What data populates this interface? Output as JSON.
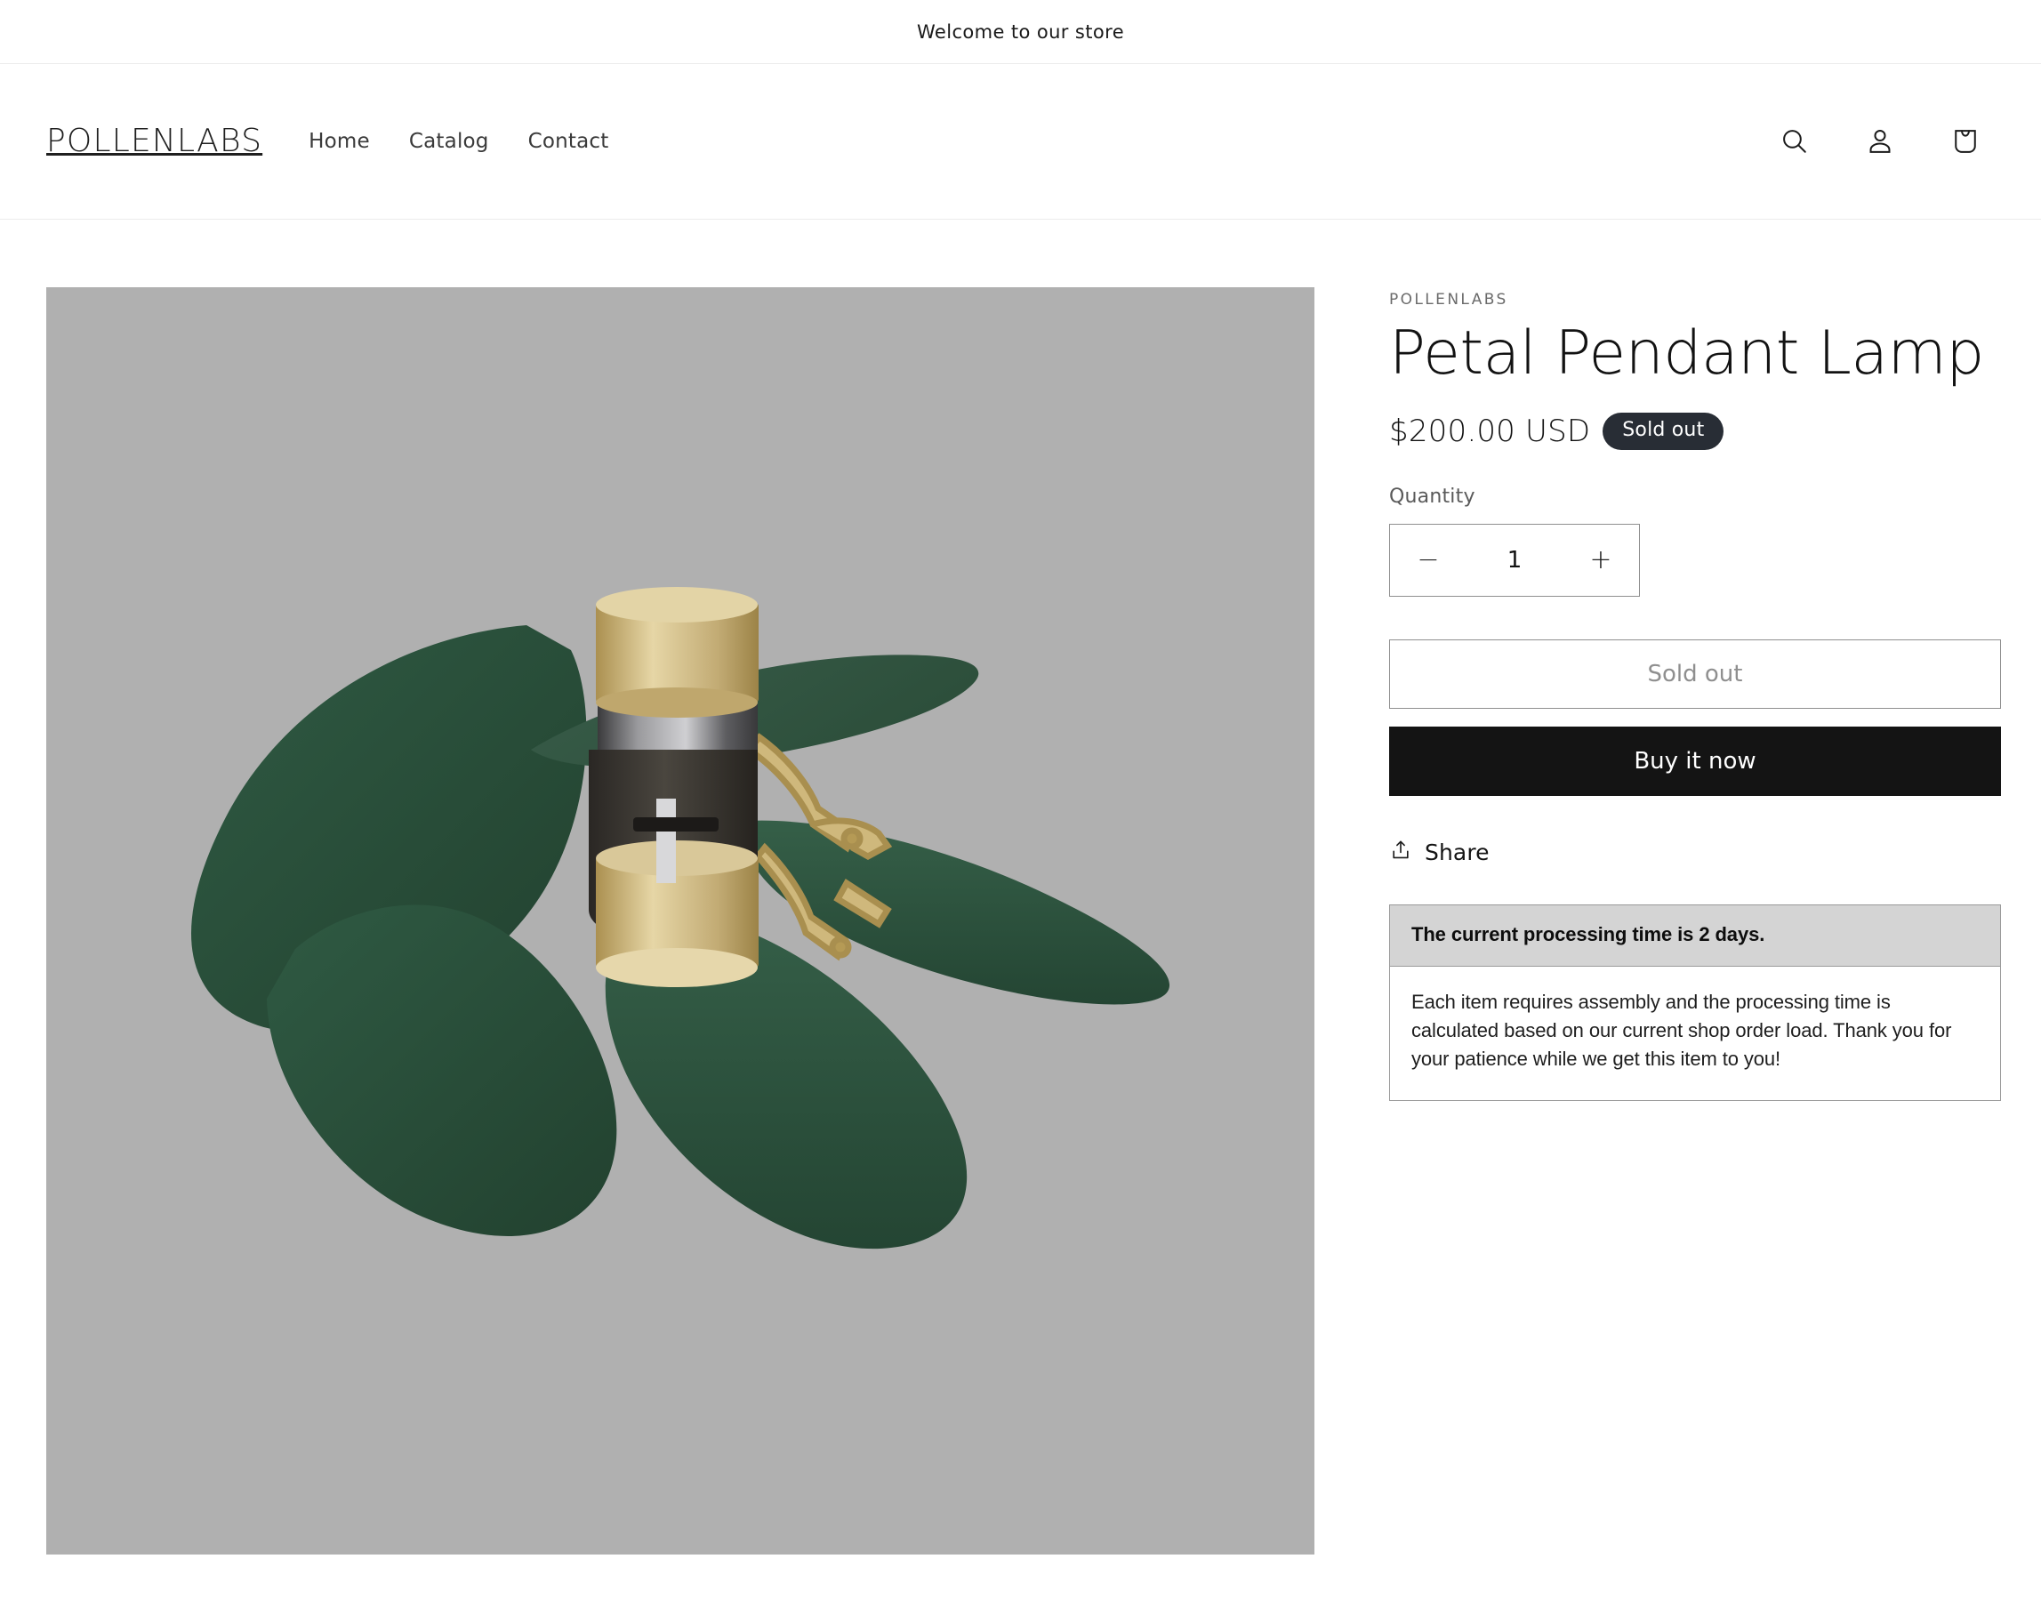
{
  "announcement": {
    "text": "Welcome to our store"
  },
  "header": {
    "logo": "POLLENLABS",
    "nav": [
      {
        "label": "Home"
      },
      {
        "label": "Catalog"
      },
      {
        "label": "Contact"
      }
    ],
    "icons": {
      "search": "search-icon",
      "account": "account-icon",
      "cart": "cart-icon"
    }
  },
  "product": {
    "vendor": "POLLENLABS",
    "title": "Petal Pendant Lamp",
    "price": "$200.00 USD",
    "availability_badge": "Sold out",
    "quantity": {
      "label": "Quantity",
      "value": "1",
      "decrease": "−",
      "increase": "+"
    },
    "actions": {
      "add_to_cart": "Sold out",
      "buy_now": "Buy it now"
    },
    "share": {
      "label": "Share",
      "icon": "share-icon"
    },
    "info_card": {
      "heading": "The current processing time is 2 days.",
      "body": "Each item requires assembly and the processing time is calculated based on our current shop order load. Thank you for your patience while we get this item to you!"
    },
    "media": {
      "alt": "Petal Pendant Lamp product render",
      "background_color": "#b0b0b0",
      "petal_color": "#2d5440",
      "brass_color": "#cdb87b"
    }
  },
  "colors": {
    "accent_dark": "#141414",
    "badge_background": "#282d35",
    "border": "#8f8f8f",
    "muted_text": "#6b6b6b"
  }
}
